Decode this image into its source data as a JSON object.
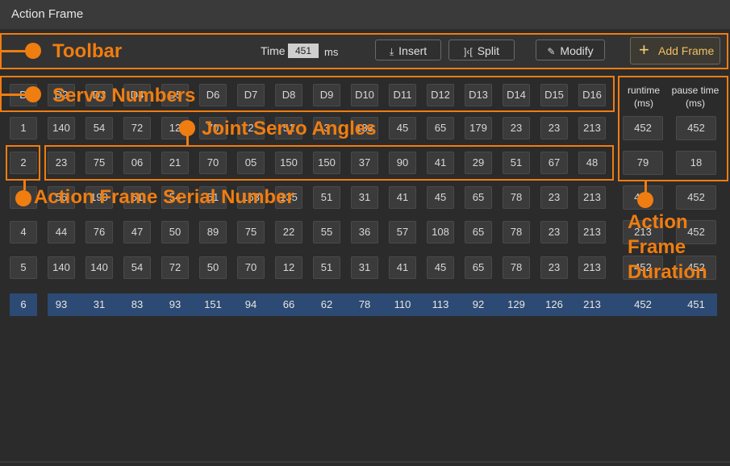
{
  "window": {
    "title": "Action Frame"
  },
  "toolbar": {
    "time_label": "Time",
    "time_value": "451",
    "time_unit": "ms",
    "insert_label": "Insert",
    "split_label": "Split",
    "modify_label": "Modify",
    "add_frame_label": "Add Frame",
    "insert_icon": "insert-icon",
    "split_icon": "split-icon",
    "modify_icon": "pencil-icon",
    "add_icon": "plus-icon"
  },
  "grid": {
    "servo_headers": [
      "D",
      "D2",
      "D3",
      "D4",
      "D5",
      "D6",
      "D7",
      "D8",
      "D9",
      "D10",
      "D11",
      "D12",
      "D13",
      "D14",
      "D15",
      "D16"
    ],
    "duration_headers": {
      "runtime": "runtime",
      "runtime_unit": "(ms)",
      "pause": "pause time",
      "pause_unit": "(ms)"
    },
    "rows": [
      {
        "index": "1",
        "angles": [
          "140",
          "54",
          "72",
          "12",
          "70",
          "2",
          "51",
          "3",
          "133",
          "45",
          "65",
          "179",
          "23",
          "23",
          "213"
        ],
        "runtime": "452",
        "pause": "452"
      },
      {
        "index": "2",
        "angles": [
          "23",
          "75",
          "06",
          "21",
          "70",
          "05",
          "150",
          "150",
          "37",
          "90",
          "41",
          "29",
          "51",
          "67",
          "48"
        ],
        "runtime": "79",
        "pause": "18"
      },
      {
        "index": "3",
        "angles": [
          "56",
          "190",
          "51",
          "54",
          "51",
          "163",
          "135",
          "51",
          "31",
          "41",
          "45",
          "65",
          "78",
          "23",
          "213"
        ],
        "runtime": "452",
        "pause": "452"
      },
      {
        "index": "4",
        "angles": [
          "44",
          "76",
          "47",
          "50",
          "89",
          "75",
          "22",
          "55",
          "36",
          "57",
          "108",
          "65",
          "78",
          "23",
          "213"
        ],
        "runtime": "213",
        "pause": "452"
      },
      {
        "index": "5",
        "angles": [
          "140",
          "140",
          "54",
          "72",
          "50",
          "70",
          "12",
          "51",
          "31",
          "41",
          "45",
          "65",
          "78",
          "23",
          "213"
        ],
        "runtime": "452",
        "pause": "452"
      },
      {
        "index": "6",
        "angles": [
          "93",
          "31",
          "83",
          "93",
          "151",
          "94",
          "66",
          "62",
          "78",
          "110",
          "113",
          "92",
          "129",
          "126",
          "213"
        ],
        "runtime": "452",
        "pause": "451"
      }
    ]
  },
  "annotations": {
    "toolbar": "Toolbar",
    "servo_numbers": "Servo Numbers",
    "joint_servo_angles": "Joint Servo Angles",
    "action_frame_serial": "Action Frame Serial Number",
    "action_frame_duration_1": "Action",
    "action_frame_duration_2": "Frame",
    "action_frame_duration_3": "Duration"
  },
  "colors": {
    "accent": "#f07d10",
    "selected_row": "#2c4a73",
    "add_frame_text": "#f0c060"
  }
}
